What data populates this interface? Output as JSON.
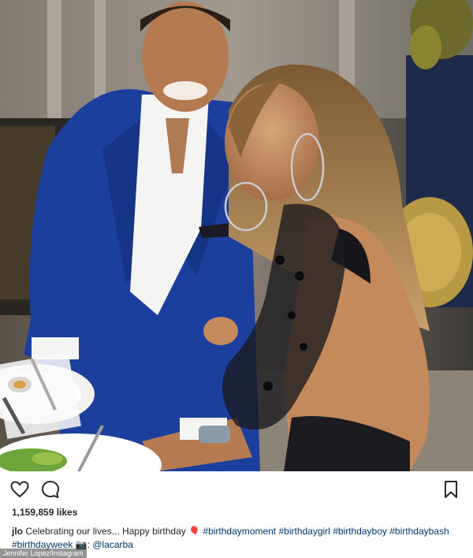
{
  "post": {
    "photo_alt": "Couple seated at a dinner table",
    "actions": {
      "like_icon": "heart-icon",
      "comment_icon": "speech-bubble-icon",
      "save_icon": "bookmark-icon"
    },
    "likes": "1,159,859 likes",
    "caption": {
      "username": "jlo",
      "text_1": " Celebrating our lives... Happy birthday ",
      "emoji_1": "🎈",
      "tag_1": "#birthdaymoment",
      "tag_2": "#birthdaygirl",
      "tag_3": "#birthdayboy",
      "tag_4": "#birthdaybash",
      "tag_5": "#birthdayweek",
      "camera": "📷:",
      "mention": "@lacarba"
    },
    "watermark": "Jennifer Lopez/Instagram"
  },
  "colors": {
    "text": "#262626",
    "tag": "#003569",
    "suit": "#1c3f9e"
  }
}
